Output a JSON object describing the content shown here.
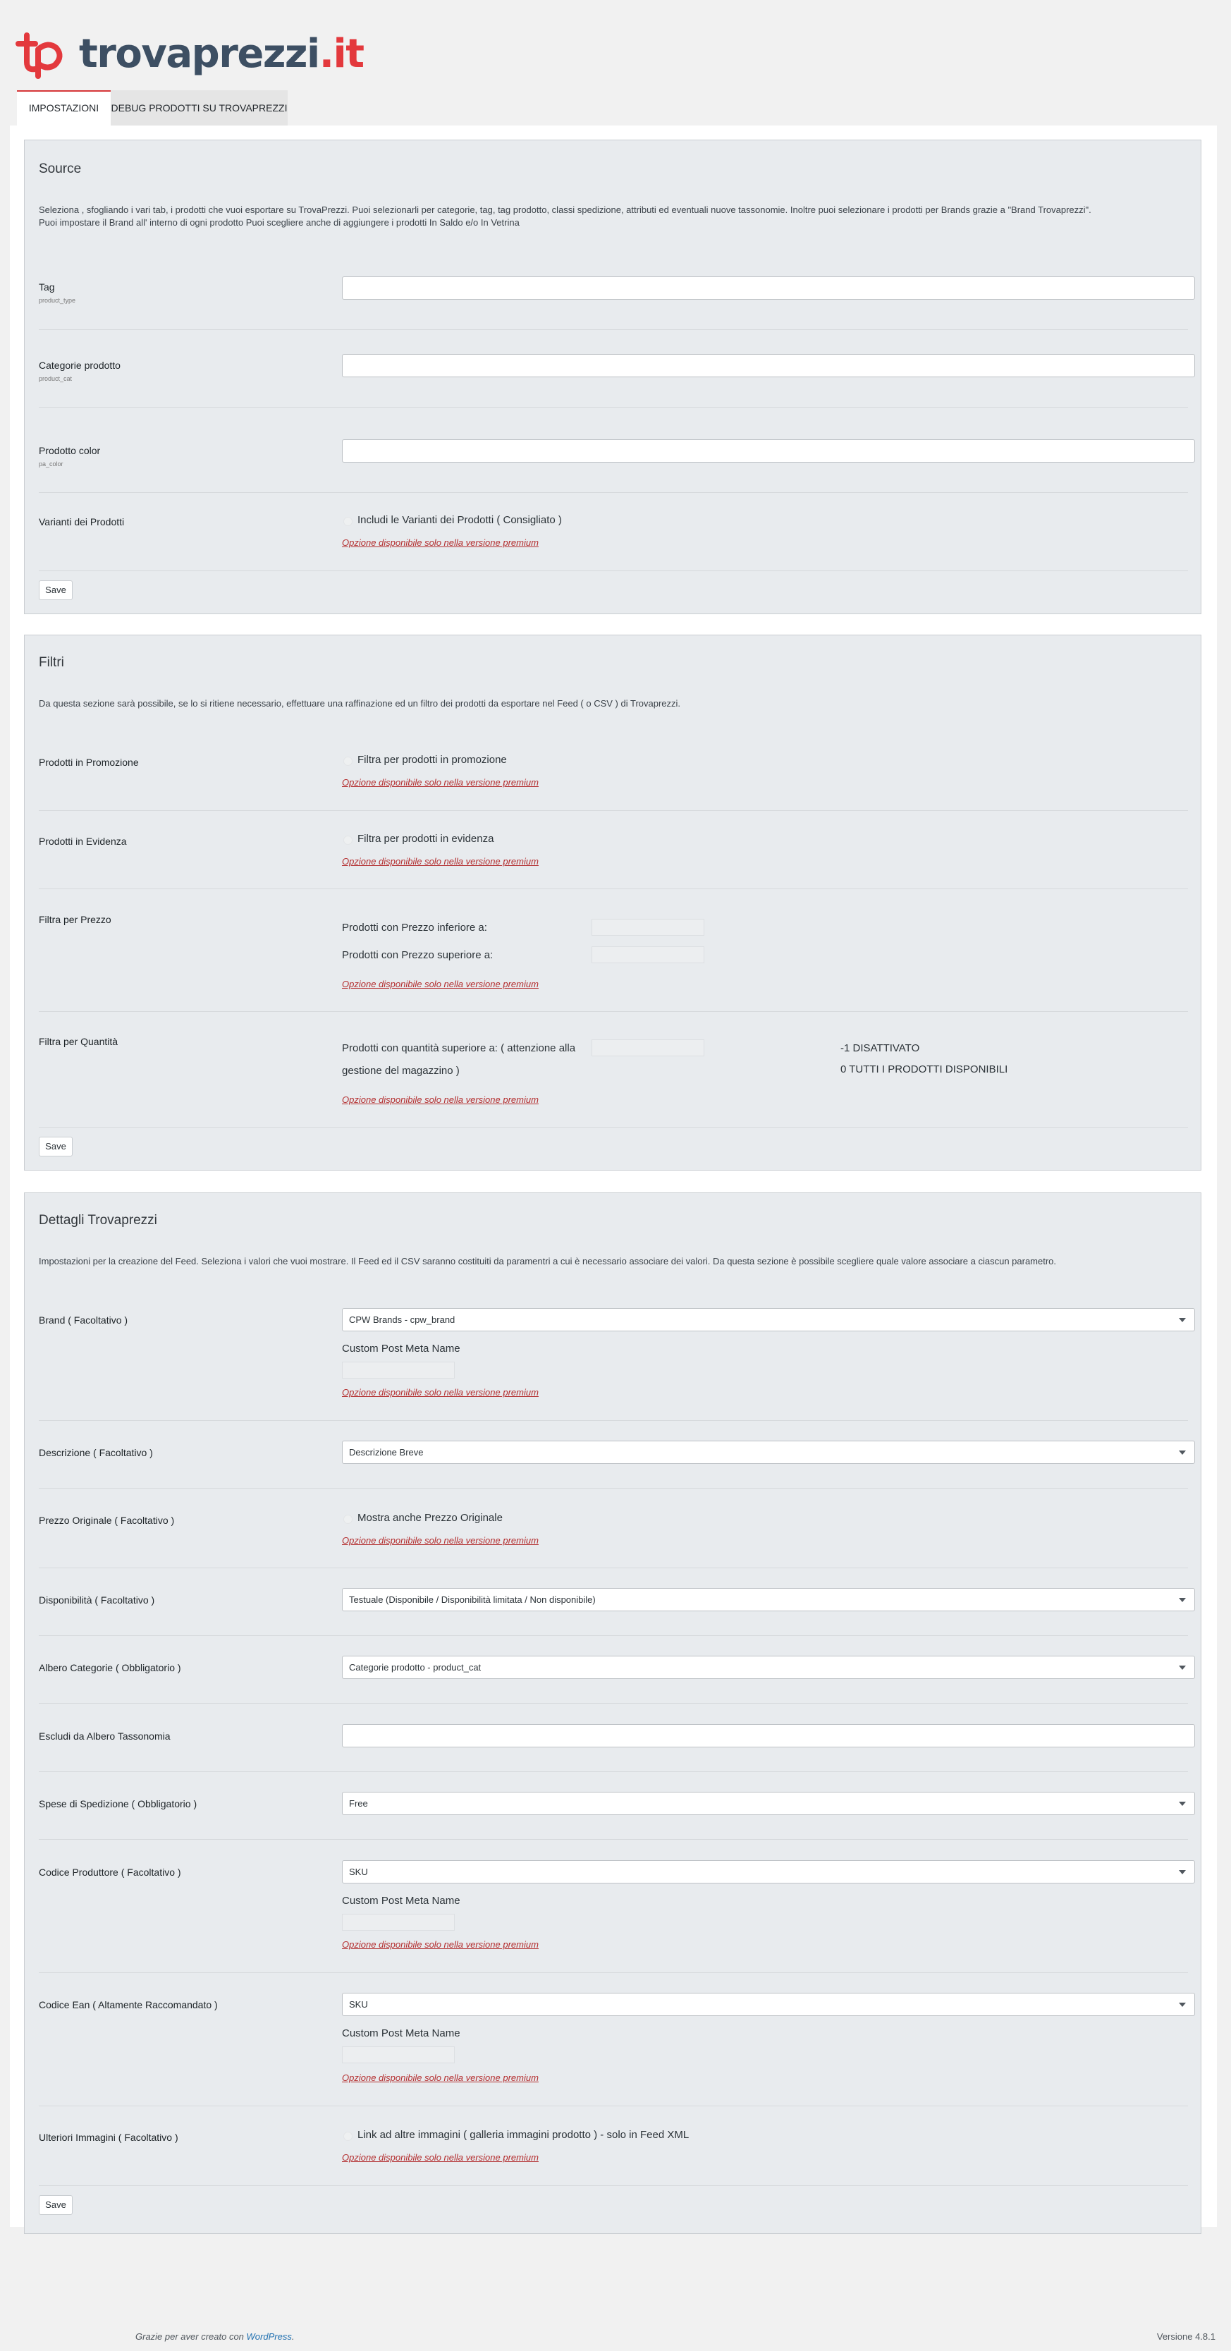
{
  "logo": {
    "name": "trovaprezzi",
    "tld": ".it"
  },
  "tabs": [
    {
      "label": "IMPOSTAZIONI",
      "active": true
    },
    {
      "label": "DEBUG PRODOTTI SU TROVAPREZZI",
      "active": false
    }
  ],
  "premium_note": "Opzione disponibile solo nella versione premium",
  "save_label": "Save",
  "custom_meta_label": "Custom Post Meta Name",
  "source": {
    "title": "Source",
    "desc1": "Seleziona , sfogliando i vari tab, i prodotti che vuoi esportare su TrovaPrezzi. Puoi selezionarli per categorie, tag, tag prodotto, classi spedizione, attributi ed eventuali nuove tassonomie. Inoltre puoi selezionare i prodotti per Brands grazie a \"Brand Trovaprezzi\".",
    "desc2": "Puoi impostare il Brand all' interno di ogni prodotto Puoi scegliere anche di aggiungere i prodotti In Saldo e/o In Vetrina",
    "tag_label": "Tag",
    "tag_sub": "product_type",
    "cat_label": "Categorie prodotto",
    "cat_sub": "product_cat",
    "color_label": "Prodotto color",
    "color_sub": "pa_color",
    "variants_label": "Varianti dei Prodotti",
    "variants_cb": "Includi le Varianti dei Prodotti ( Consigliato )"
  },
  "filtri": {
    "title": "Filtri",
    "desc": "Da questa sezione sarà possibile, se lo si ritiene necessario, effettuare una raffinazione ed un filtro dei prodotti da esportare nel Feed ( o CSV ) di Trovaprezzi.",
    "promo_label": "Prodotti in Promozione",
    "promo_cb": "Filtra per prodotti in promozione",
    "evidenza_label": "Prodotti in Evidenza",
    "evidenza_cb": "Filtra per prodotti in evidenza",
    "prezzo_label": "Filtra per Prezzo",
    "prezzo_inf": "Prodotti con Prezzo inferiore a:",
    "prezzo_sup": "Prodotti con Prezzo superiore a:",
    "qty_label": "Filtra per Quantità",
    "qty_text1": "Prodotti con quantità superiore a: ( attenzione alla",
    "qty_text2": "gestione del magazzino )",
    "qty_note1": "-1 DISATTIVATO",
    "qty_note2": "0 TUTTI I PRODOTTI DISPONIBILI"
  },
  "dettagli": {
    "title": "Dettagli Trovaprezzi",
    "desc": "Impostazioni per la creazione del Feed. Seleziona i valori che vuoi mostrare. Il Feed ed il CSV saranno costituiti da paramentri a cui è necessario associare dei valori. Da questa sezione è possibile scegliere quale valore associare a ciascun parametro.",
    "brand_label": "Brand ( Facoltativo )",
    "brand_value": "CPW Brands - cpw_brand",
    "desc_label": "Descrizione ( Facoltativo )",
    "desc_value": "Descrizione Breve",
    "prezzo_label": "Prezzo Originale ( Facoltativo )",
    "prezzo_cb": "Mostra anche Prezzo Originale",
    "disp_label": "Disponibilità ( Facoltativo )",
    "disp_value": "Testuale (Disponibile / Disponibilità limitata / Non disponibile)",
    "albero_label": "Albero Categorie ( Obbligatorio )",
    "albero_value": "Categorie prodotto - product_cat",
    "escludi_label": "Escludi da Albero Tassonomia",
    "spese_label": "Spese di Spedizione ( Obbligatorio )",
    "spese_value": "Free",
    "produttore_label": "Codice Produttore ( Facoltativo )",
    "produttore_value": "SKU",
    "ean_label": "Codice Ean ( Altamente Raccomandato )",
    "ean_value": "SKU",
    "immagini_label": "Ulteriori Immagini ( Facoltativo )",
    "immagini_cb": "Link ad altre immagini ( galleria immagini prodotto ) - solo in Feed XML"
  },
  "footer": {
    "thanks": "Grazie per aver creato con",
    "wp": "WordPress",
    "dot": ".",
    "version": "Versione 4.8.1"
  },
  "colors": {
    "accent": "#d63638",
    "logo_dark": "#3d4f63",
    "link": "#2271b1",
    "premium": "#b32d2e"
  },
  "icons": [
    "tp-logo-icon",
    "chevron-down-icon"
  ]
}
